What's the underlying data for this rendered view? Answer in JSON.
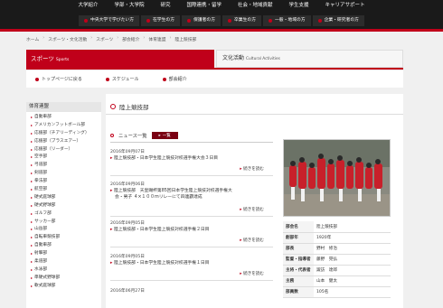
{
  "topnav": [
    "大学紹介",
    "学部・大学院",
    "研究",
    "国際連携・留学",
    "社会・地域貢献",
    "学生支援",
    "キャリアサポート"
  ],
  "subnav": [
    "中央大学で学びたい方",
    "在学生の方",
    "保護者の方",
    "卒業生の方",
    "一般・地域の方",
    "企業・研究者の方"
  ],
  "breadcrumb": [
    "ホーム",
    "スポーツ・文化活動",
    "スポーツ",
    "部会紹介",
    "体育連盟",
    "陸上競技部"
  ],
  "tabs": {
    "sports": "スポーツ",
    "sports_en": "Sports",
    "cultural": "文化活動",
    "cultural_en": "Cultural Activities"
  },
  "toolbar": [
    "トップページに戻る",
    "スケジュール",
    "部会紹介"
  ],
  "sidebar": {
    "heading": "体育連盟",
    "items": [
      "自動車部",
      "アメリカンフットボール部",
      "応援部（チアリーディング）",
      "応援部（ブラスエアー）",
      "応援部（リーダー）",
      "空手部",
      "弓道部",
      "剣道部",
      "拳法部",
      "航空部",
      "硬式庭球部",
      "硬式野球部",
      "ゴルフ部",
      "サッカー部",
      "山岳部",
      "自転車競技部",
      "自動車部",
      "射撃部",
      "柔道部",
      "水泳部",
      "準硬式野球部",
      "軟式庭球部"
    ]
  },
  "main": {
    "title": "陸上競技部",
    "news_heading": "ニュース一覧",
    "list_button": "一覧",
    "more": "続きを読む",
    "entries": [
      {
        "date": "2016年09月07日",
        "lines": [
          "陸上競技部・日本学生陸上競技対校選手権大会３日目"
        ]
      },
      {
        "date": "2016年09月06日",
        "lines": [
          "陸上競技部　天皇賜杯第85回日本学生陸上競技対校選手権大",
          "会・男子 ４×１００ｍリレーにて四連覇達成"
        ]
      },
      {
        "date": "2016年09月05日",
        "lines": [
          "陸上競技部・日本学生陸上競技対校選手権２日目"
        ]
      },
      {
        "date": "2016年09月05日",
        "lines": [
          "陸上競技部・日本学生陸上競技対校選手権１日目"
        ]
      },
      {
        "date": "2016年06月27日",
        "lines": []
      }
    ]
  },
  "info": [
    {
      "label": "部会名",
      "value": "陸上競技部"
    },
    {
      "label": "創部年",
      "value": "1920年"
    },
    {
      "label": "部長",
      "value": "野村　修治"
    },
    {
      "label": "監督・指導者",
      "value": "藤野　晃弘"
    },
    {
      "label": "主将・代表者",
      "value": "諏訪　達郎"
    },
    {
      "label": "主務",
      "value": "山本　健太"
    },
    {
      "label": "部員数",
      "value": "105名"
    }
  ],
  "colors": {
    "accent": "#c0001a",
    "nav": "#1a1a1a"
  }
}
